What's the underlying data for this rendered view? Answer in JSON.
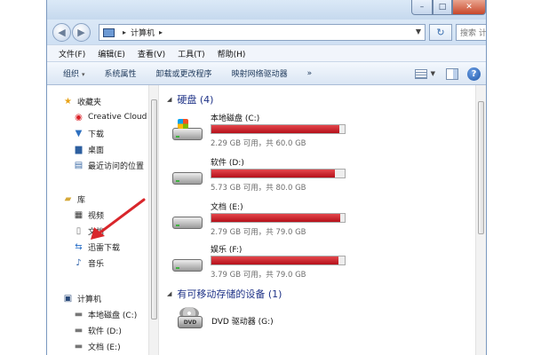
{
  "window": {
    "controls": {
      "minimize": "–",
      "maximize": "□",
      "close": "✕"
    }
  },
  "nav": {
    "back_icon": "back-arrow-icon",
    "forward_icon": "forward-arrow-icon",
    "address": {
      "root_sep": "▸",
      "location": "计算机",
      "trail_sep": "▸"
    },
    "search_placeholder": "搜索 计算机"
  },
  "menu": [
    "文件(F)",
    "编辑(E)",
    "查看(V)",
    "工具(T)",
    "帮助(H)"
  ],
  "toolbar": {
    "items": [
      "组织",
      "系统属性",
      "卸载或更改程序",
      "映射网络驱动器",
      "»"
    ],
    "organize_chevron": "▾"
  },
  "sidebar": {
    "favorites": {
      "label": "收藏夹",
      "items": [
        "Creative Cloud",
        "下载",
        "桌面",
        "最近访问的位置"
      ]
    },
    "library": {
      "label": "库",
      "items": [
        "视频",
        "文档",
        "迅雷下载",
        "音乐"
      ]
    },
    "computer": {
      "label": "计算机",
      "items": [
        "本地磁盘 (C:)",
        "软件 (D:)",
        "文档 (E:)"
      ]
    }
  },
  "content": {
    "hard_disks_header": "硬盘 (4)",
    "drives": [
      {
        "name": "本地磁盘 (C:)",
        "info": "2.29 GB 可用，共 60.0 GB",
        "used_fraction": 0.962
      },
      {
        "name": "软件 (D:)",
        "info": "5.73 GB 可用，共 80.0 GB",
        "used_fraction": 0.928
      },
      {
        "name": "文档 (E:)",
        "info": "2.79 GB 可用，共 79.0 GB",
        "used_fraction": 0.965
      },
      {
        "name": "娱乐 (F:)",
        "info": "3.79 GB 可用，共 79.0 GB",
        "used_fraction": 0.952
      }
    ],
    "removable_header": "有可移动存储的设备 (1)",
    "dvd": {
      "name": "DVD 驱动器 (G:)",
      "badge": "DVD"
    }
  },
  "colors": {
    "usage_bar": "#c8141e",
    "header_text": "#1e3287",
    "annotation_arrow": "#d9262b"
  }
}
